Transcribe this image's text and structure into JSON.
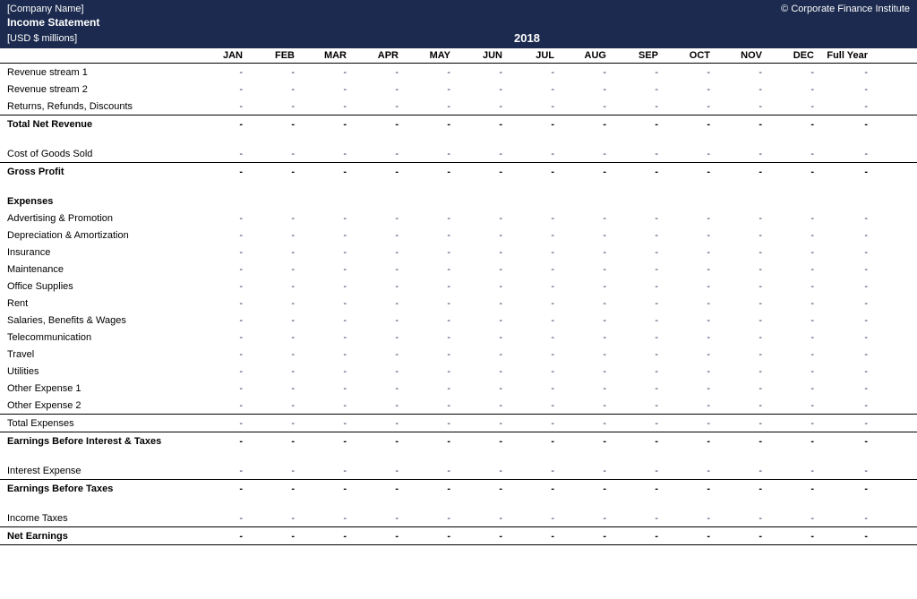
{
  "header": {
    "company": "[Company Name]",
    "copyright": "© Corporate Finance Institute",
    "subtitle": "Income Statement",
    "units": "[USD $ millions]",
    "year": "2018"
  },
  "columns": [
    "JAN",
    "FEB",
    "MAR",
    "APR",
    "MAY",
    "JUN",
    "JUL",
    "AUG",
    "SEP",
    "OCT",
    "NOV",
    "DEC",
    "Full Year"
  ],
  "rows": [
    {
      "label": "Revenue stream 1",
      "type": "data",
      "value": "-"
    },
    {
      "label": "Revenue stream 2",
      "type": "data",
      "value": "-"
    },
    {
      "label": "Returns, Refunds, Discounts",
      "type": "data",
      "value": "-"
    },
    {
      "label": "Total Net Revenue",
      "type": "total",
      "value": "-"
    },
    {
      "label": "",
      "type": "spacer"
    },
    {
      "label": "Cost of Goods Sold",
      "type": "data",
      "value": "-"
    },
    {
      "label": "Gross Profit",
      "type": "total",
      "value": "-"
    },
    {
      "label": "",
      "type": "spacer"
    },
    {
      "label": "Expenses",
      "type": "section"
    },
    {
      "label": "Advertising & Promotion",
      "type": "data",
      "value": "-"
    },
    {
      "label": "Depreciation & Amortization",
      "type": "data",
      "value": "-"
    },
    {
      "label": "Insurance",
      "type": "data",
      "value": "-"
    },
    {
      "label": "Maintenance",
      "type": "data",
      "value": "-"
    },
    {
      "label": "Office Supplies",
      "type": "data",
      "value": "-"
    },
    {
      "label": "Rent",
      "type": "data",
      "value": "-"
    },
    {
      "label": "Salaries, Benefits & Wages",
      "type": "data",
      "value": "-"
    },
    {
      "label": "Telecommunication",
      "type": "data",
      "value": "-"
    },
    {
      "label": "Travel",
      "type": "data",
      "value": "-"
    },
    {
      "label": "Utilities",
      "type": "data",
      "value": "-"
    },
    {
      "label": "Other Expense 1",
      "type": "data",
      "value": "-"
    },
    {
      "label": "Other Expense 2",
      "type": "data",
      "value": "-"
    },
    {
      "label": "Total Expenses",
      "type": "subtotal",
      "value": "-"
    },
    {
      "label": "Earnings Before Interest & Taxes",
      "type": "total",
      "value": "-"
    },
    {
      "label": "",
      "type": "spacer"
    },
    {
      "label": "Interest Expense",
      "type": "data",
      "value": "-"
    },
    {
      "label": "Earnings Before Taxes",
      "type": "total",
      "value": "-"
    },
    {
      "label": "",
      "type": "spacer"
    },
    {
      "label": "Income Taxes",
      "type": "data",
      "value": "-"
    },
    {
      "label": "Net Earnings",
      "type": "grand",
      "value": "-"
    }
  ]
}
